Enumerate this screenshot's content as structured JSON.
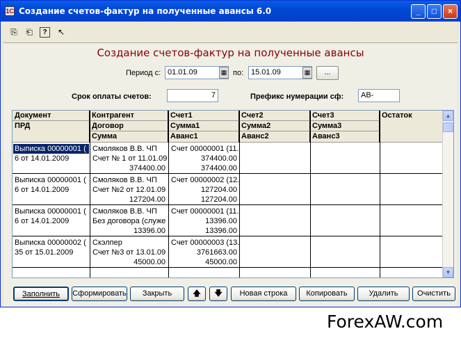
{
  "window": {
    "title": "Создание счетов-фактур на полученные авансы 6.0",
    "app_icon": "1С"
  },
  "window_buttons": {
    "minimize": "_",
    "maximize": "□",
    "close": "×"
  },
  "toolbar": {
    "icons": [
      "open-icon",
      "save-icon",
      "help-icon",
      "pointer-help-icon"
    ],
    "glyphs": [
      "⎘",
      "⎗",
      "?",
      "↖"
    ]
  },
  "form": {
    "heading": "Создание счетов-фактур на полученные авансы",
    "period_label": "Период с:",
    "period_from": "01.01.09",
    "period_to_label": "по:",
    "period_to": "15.01.09",
    "period_button": "...",
    "payment_term_label": "Срок оплаты счетов:",
    "payment_term": "7",
    "prefix_label": "Префикс нумерации сф:",
    "prefix": "АВ-"
  },
  "grid": {
    "headers": {
      "col1": [
        "Документ",
        "ПРД"
      ],
      "col2": [
        "Контрагент",
        "Договор",
        "Сумма"
      ],
      "col3": [
        "Счет1",
        "Сумма1",
        "Аванс1"
      ],
      "col4": [
        "Счет2",
        "Сумма2",
        "Аванс2"
      ],
      "col5": [
        "Счет3",
        "Сумма3",
        "Аванс3"
      ],
      "col6": [
        "Остаток"
      ]
    },
    "rows": [
      {
        "doc": [
          "Выписка 00000001 (",
          "6 от 14.01.2009"
        ],
        "contr": [
          "Смоляков В.В. ЧП",
          "Счет № 1 от 11.01.09",
          "374400.00"
        ],
        "acc1": [
          "Счет 00000001 (11.",
          "374400.00",
          "374400.00"
        ]
      },
      {
        "doc": [
          "Выписка 00000001 (",
          "6 от 14.01.2009"
        ],
        "contr": [
          "Смоляков В.В. ЧП",
          "Счет №2 от 12.01.09",
          "127204.00"
        ],
        "acc1": [
          "Счет 00000002 (12.",
          "127204.00",
          "127204.00"
        ]
      },
      {
        "doc": [
          "Выписка 00000001 (",
          "6 от 14.01.2009"
        ],
        "contr": [
          "Смоляков В.В. ЧП",
          "Без договора (служе",
          "13396.00"
        ],
        "acc1": [
          "Счет 00000001 (11.",
          "13396.00",
          "13396.00"
        ]
      },
      {
        "doc": [
          "Выписка 00000002 (",
          "35 от 15.01.2009"
        ],
        "contr": [
          "Скэлпер",
          "Счет №3 от 13.01.09",
          "45000.00"
        ],
        "acc1": [
          "Счет 00000003 (13.",
          "3761663.00",
          "45000.00"
        ]
      }
    ]
  },
  "buttons": {
    "fill": "Заполнить",
    "form": "Сформировать",
    "close": "Закрыть",
    "up": "🡅",
    "down": "🡇",
    "new_row": "Новая строка",
    "copy": "Копировать",
    "delete": "Удалить",
    "clear": "Очистить"
  },
  "watermark": "ForexAW.com"
}
